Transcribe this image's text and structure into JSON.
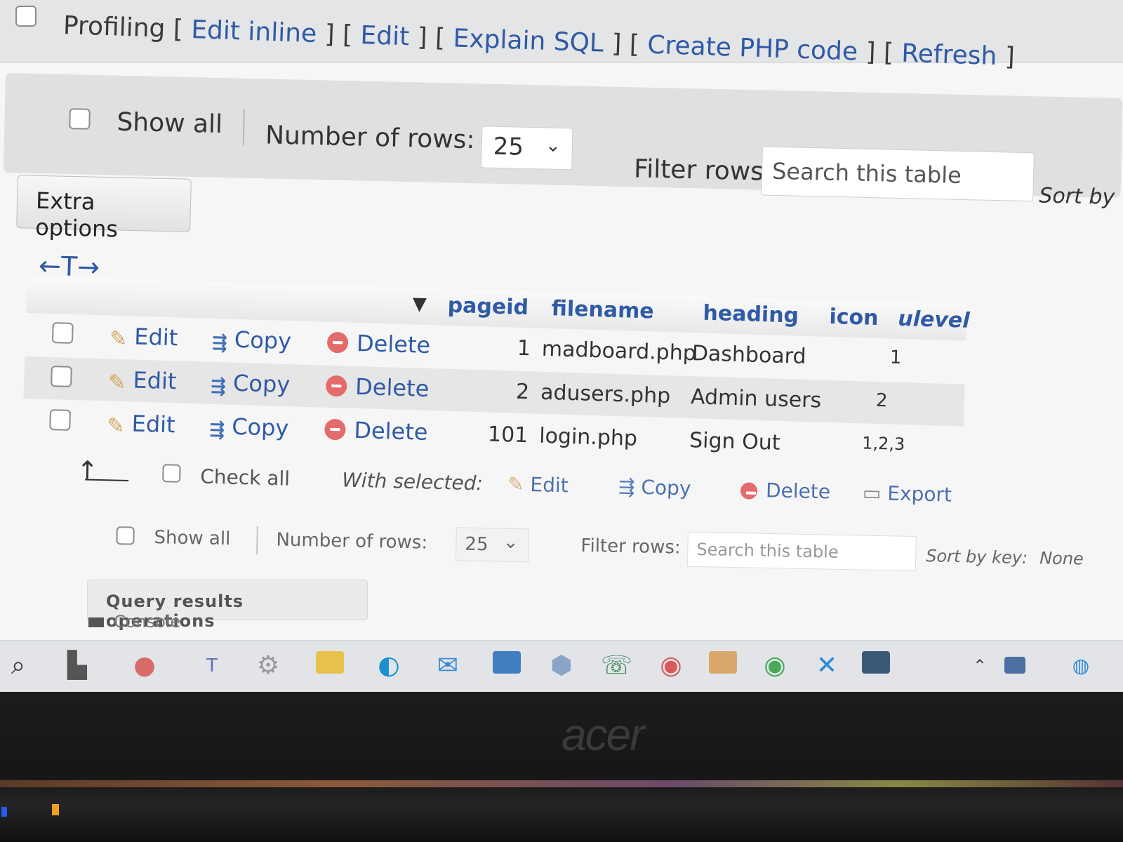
{
  "profiling": {
    "label": "Profiling",
    "links": [
      "Edit inline",
      "Edit",
      "Explain SQL",
      "Create PHP code",
      "Refresh"
    ]
  },
  "navbar": {
    "show_all": "Show all",
    "rows_label": "Number of rows:",
    "rows_value": "25",
    "filter_label": "Filter rows:",
    "filter_placeholder": "Search this table",
    "sort_by": "Sort by"
  },
  "extra_options": "Extra options",
  "table": {
    "col_arrows": "←T→",
    "columns": [
      "pageid",
      "filename",
      "heading",
      "icon",
      "ulevel"
    ],
    "actions": {
      "edit": "Edit",
      "copy": "Copy",
      "delete": "Delete"
    },
    "rows": [
      {
        "pageid": "1",
        "filename": "madboard.php",
        "heading": "Dashboard",
        "icon": "",
        "ulevel": "1"
      },
      {
        "pageid": "2",
        "filename": "adusers.php",
        "heading": "Admin users",
        "icon": "",
        "ulevel": "2"
      },
      {
        "pageid": "101",
        "filename": "login.php",
        "heading": "Sign Out",
        "icon": "",
        "ulevel": "1,2,3"
      }
    ]
  },
  "bulk": {
    "check_all": "Check all",
    "with_selected": "With selected:",
    "edit": "Edit",
    "copy": "Copy",
    "delete": "Delete",
    "export": "Export"
  },
  "nav_bottom": {
    "show_all": "Show all",
    "rows_label": "Number of rows:",
    "rows_value": "25",
    "filter_label": "Filter rows:",
    "filter_placeholder": "Search this table",
    "sort_by_key": "Sort by key:",
    "sort_value": "None"
  },
  "query_results_operations": "Query results operations",
  "console": "Console",
  "brand": "acer"
}
